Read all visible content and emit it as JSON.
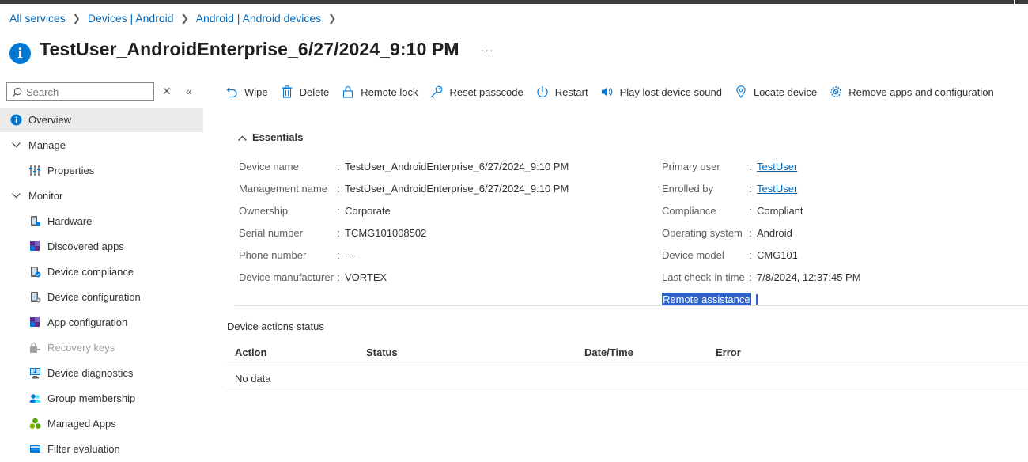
{
  "breadcrumb": [
    "All services",
    "Devices | Android",
    "Android | Android devices"
  ],
  "page": {
    "title": "TestUser_AndroidEnterprise_6/27/2024_9:10 PM",
    "more": "···"
  },
  "sidebar": {
    "search_placeholder": "Search",
    "items": [
      {
        "label": "Overview",
        "icon": "info-icon"
      },
      {
        "label": "Manage",
        "icon": "chevron-down-icon"
      },
      {
        "label": "Properties",
        "icon": "properties-icon"
      },
      {
        "label": "Monitor",
        "icon": "chevron-down-icon"
      },
      {
        "label": "Hardware",
        "icon": "hardware-icon"
      },
      {
        "label": "Discovered apps",
        "icon": "apps-icon"
      },
      {
        "label": "Device compliance",
        "icon": "compliance-icon"
      },
      {
        "label": "Device configuration",
        "icon": "configuration-icon"
      },
      {
        "label": "App configuration",
        "icon": "app-config-icon"
      },
      {
        "label": "Recovery keys",
        "icon": "key-icon"
      },
      {
        "label": "Device diagnostics",
        "icon": "diagnostics-icon"
      },
      {
        "label": "Group membership",
        "icon": "group-icon"
      },
      {
        "label": "Managed Apps",
        "icon": "managed-apps-icon"
      },
      {
        "label": "Filter evaluation",
        "icon": "filter-icon"
      }
    ]
  },
  "toolbar": {
    "wipe": "Wipe",
    "delete": "Delete",
    "remote_lock": "Remote lock",
    "reset_passcode": "Reset passcode",
    "restart": "Restart",
    "play_sound": "Play lost device sound",
    "locate": "Locate device",
    "remove_apps": "Remove apps and configuration"
  },
  "essentials": {
    "header": "Essentials",
    "left": [
      {
        "label": "Device name",
        "value": "TestUser_AndroidEnterprise_6/27/2024_9:10 PM"
      },
      {
        "label": "Management name",
        "value": "TestUser_AndroidEnterprise_6/27/2024_9:10 PM"
      },
      {
        "label": "Ownership",
        "value": "Corporate"
      },
      {
        "label": "Serial number",
        "value": "TCMG101008502"
      },
      {
        "label": "Phone number",
        "value": "---"
      },
      {
        "label": "Device manufacturer",
        "value": "VORTEX"
      }
    ],
    "right": [
      {
        "label": "Primary user",
        "value": "TestUser"
      },
      {
        "label": "Enrolled by",
        "value": "TestUser"
      },
      {
        "label": "Compliance",
        "value": "Compliant"
      },
      {
        "label": "Operating system",
        "value": "Android"
      },
      {
        "label": "Device model",
        "value": "CMG101"
      },
      {
        "label": "Last check-in time",
        "value": "7/8/2024, 12:37:45 PM"
      },
      {
        "label": "Remote assistance",
        "value": ""
      }
    ],
    "colon": ":"
  },
  "actions_status": {
    "title": "Device actions status",
    "columns": [
      "Action",
      "Status",
      "Date/Time",
      "Error"
    ],
    "empty": "No data"
  },
  "colors": {
    "accent": "#0078d4",
    "link": "#0067b8",
    "selection": "#2f62c9"
  }
}
